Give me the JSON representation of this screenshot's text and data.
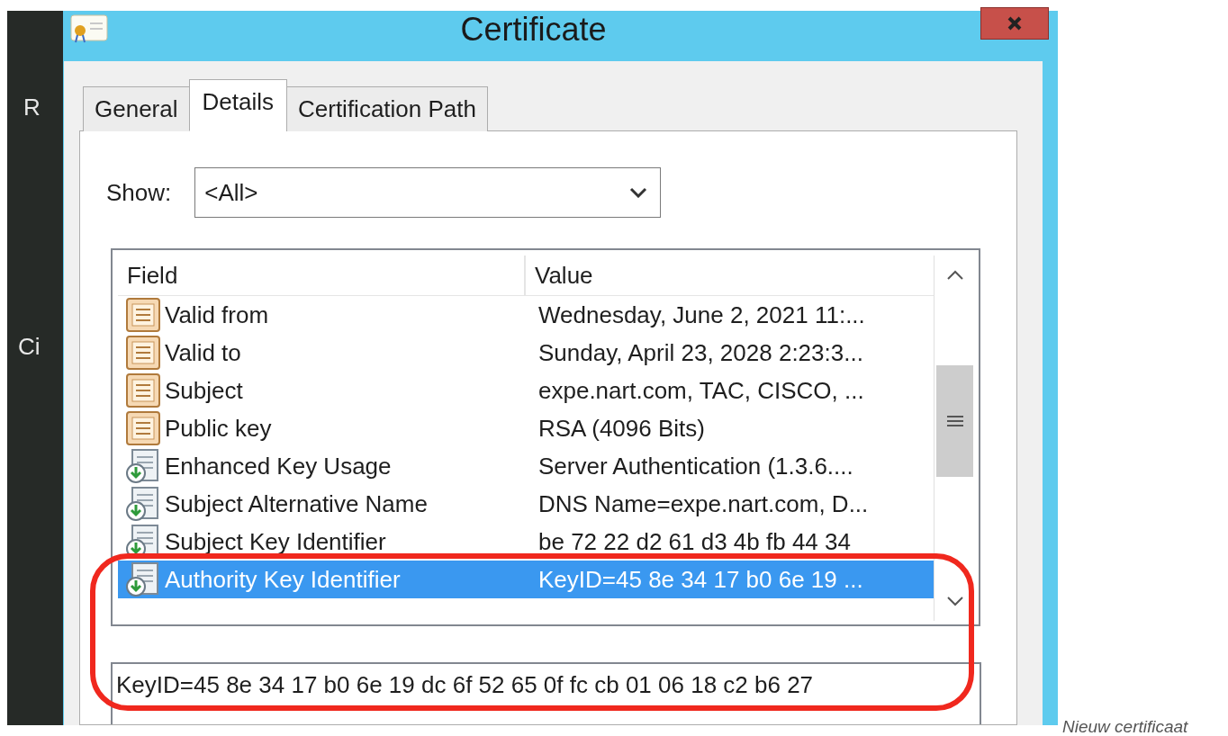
{
  "background_texts": [
    "R",
    "Ci"
  ],
  "window": {
    "title": "Certificate"
  },
  "tabs": [
    {
      "label": "General",
      "selected": false
    },
    {
      "label": "Details",
      "selected": true
    },
    {
      "label": "Certification Path",
      "selected": false
    }
  ],
  "show": {
    "label": "Show:",
    "value": "<All>"
  },
  "list": {
    "columns": [
      "Field",
      "Value"
    ],
    "rows": [
      {
        "kind": "property",
        "field": "Valid from",
        "value": "Wednesday, June 2, 2021 11:...",
        "selected": false
      },
      {
        "kind": "property",
        "field": "Valid to",
        "value": "Sunday, April 23, 2028 2:23:3...",
        "selected": false
      },
      {
        "kind": "property",
        "field": "Subject",
        "value": "expe.nart.com, TAC, CISCO, ...",
        "selected": false
      },
      {
        "kind": "property",
        "field": "Public key",
        "value": "RSA (4096 Bits)",
        "selected": false
      },
      {
        "kind": "extension",
        "field": "Enhanced Key Usage",
        "value": "Server Authentication (1.3.6....",
        "selected": false
      },
      {
        "kind": "extension",
        "field": "Subject Alternative Name",
        "value": "DNS Name=expe.nart.com, D...",
        "selected": false
      },
      {
        "kind": "extension",
        "field": "Subject Key Identifier",
        "value": "be 72 22 d2 61 d3 4b fb 44 34",
        "selected": false
      },
      {
        "kind": "extension",
        "field": "Authority Key Identifier",
        "value": "KeyID=45 8e 34 17 b0 6e 19 ...",
        "selected": true
      }
    ]
  },
  "detail": {
    "value": "KeyID=45 8e 34 17 b0 6e 19 dc 6f 52 65 0f fc cb 01 06 18 c2 b6 27"
  },
  "caption": "Nieuw certificaat"
}
